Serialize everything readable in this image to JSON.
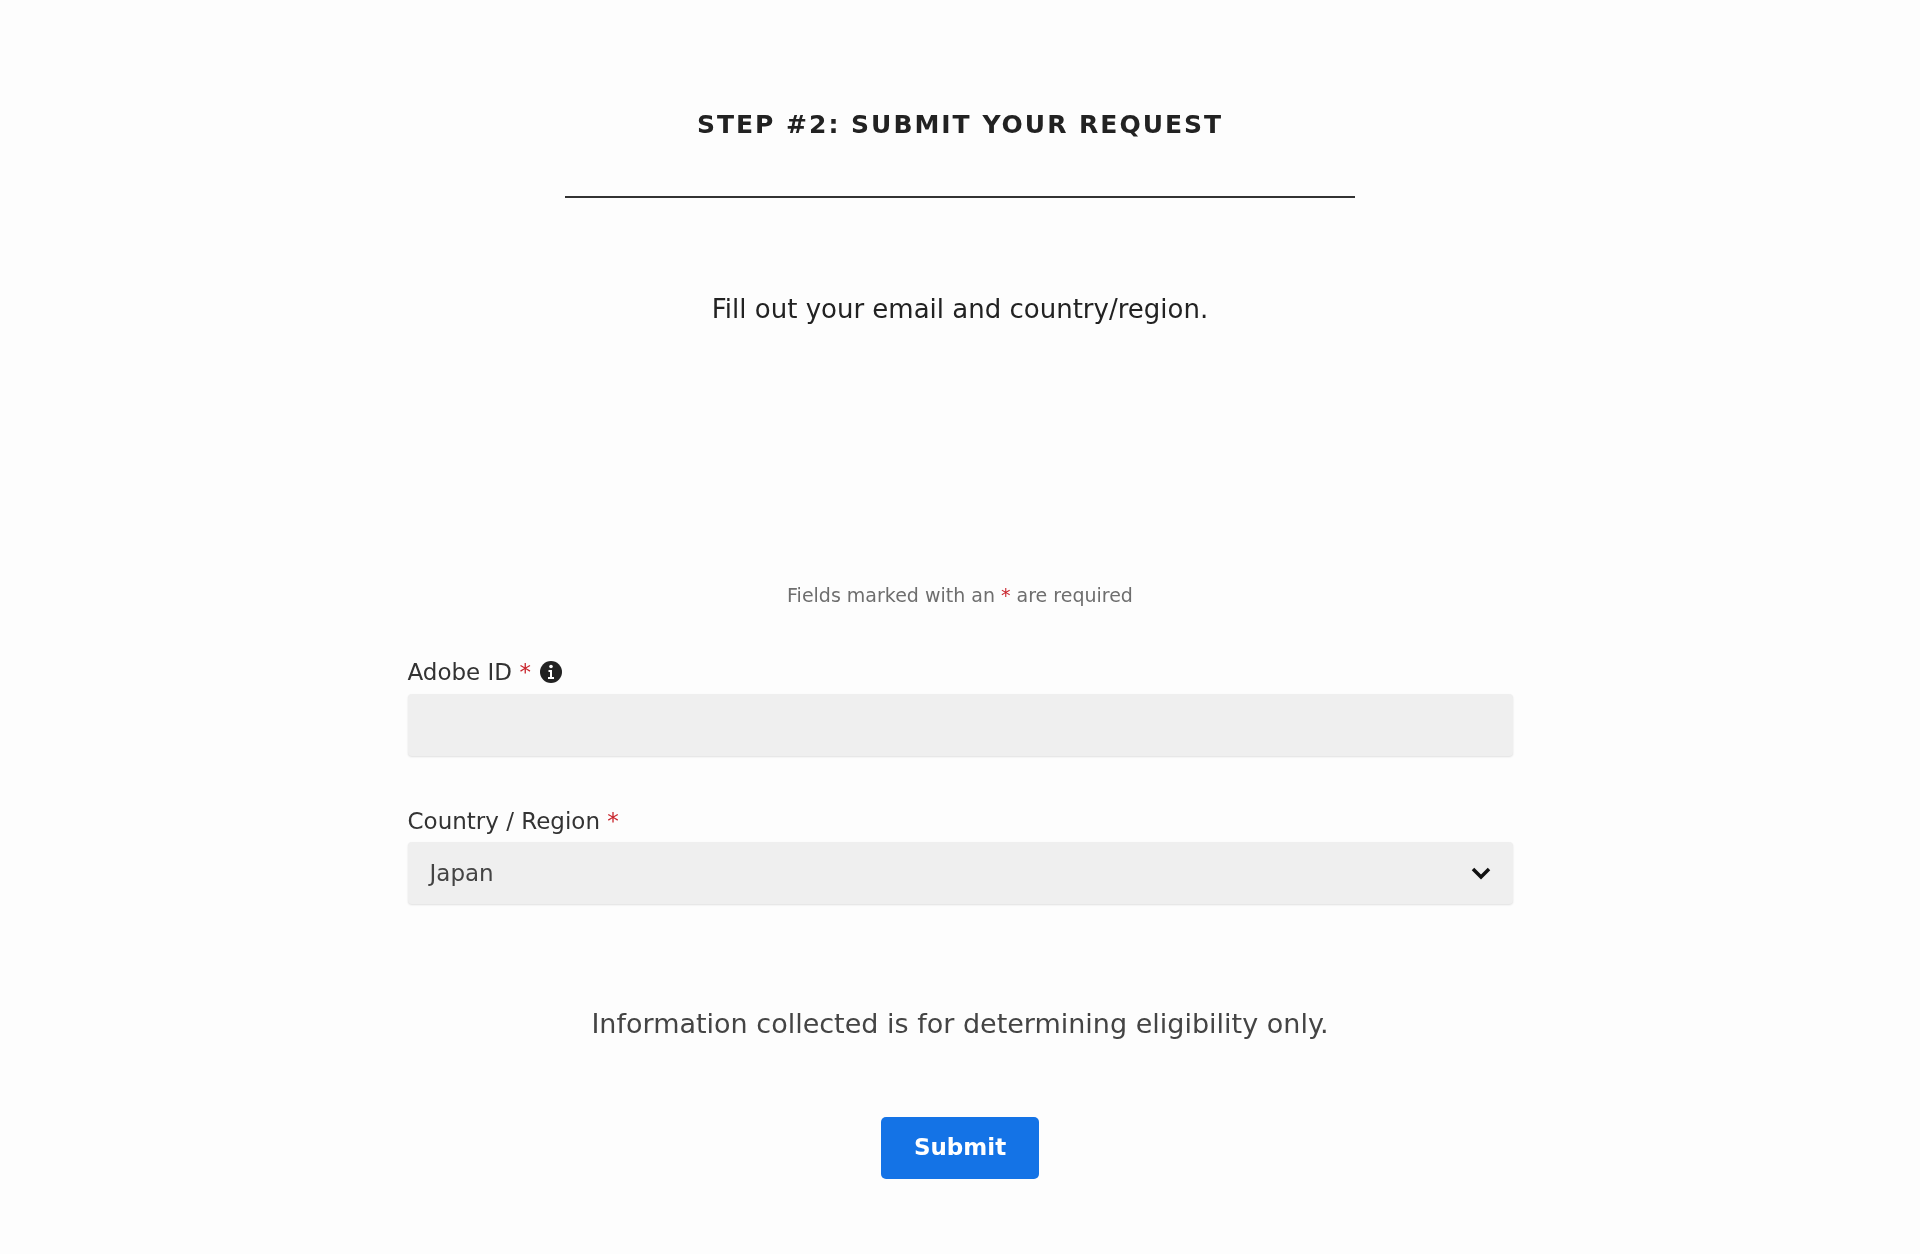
{
  "heading": "STEP #2: SUBMIT YOUR REQUEST",
  "subtitle": "Fill out your email and country/region.",
  "required_note": {
    "before": "Fields marked with an",
    "mark": "*",
    "after": "are required"
  },
  "fields": [
    {
      "kind": "text",
      "label": "Adobe ID",
      "required_mark": "*",
      "has_info": true
    },
    {
      "kind": "select",
      "label": "Country / Region",
      "required_mark": "*",
      "has_info": false,
      "value": "Japan"
    }
  ],
  "disclaimer": "Information collected is for determining eligibility only.",
  "submit": "Submit"
}
